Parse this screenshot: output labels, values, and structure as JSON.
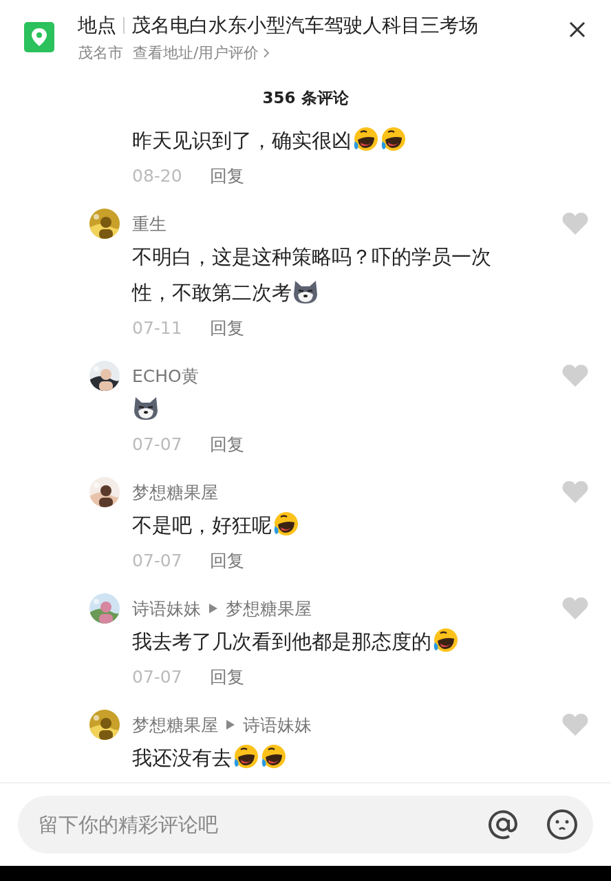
{
  "header": {
    "label": "地点",
    "title": "茂名电白水东小型汽车驾驶人科目三考场",
    "city": "茂名市",
    "link": "查看地址/用户评价"
  },
  "comment_count": "356 条评论",
  "comments": [
    {
      "parts": [
        {
          "kind": "text",
          "text": "昨天见识到了，确实很凶"
        },
        {
          "kind": "laugh-cry"
        },
        {
          "kind": "laugh-cry"
        }
      ],
      "date": "08-20",
      "reply": "回复"
    },
    {
      "author": "重生",
      "liked": false,
      "parts": [
        {
          "kind": "text",
          "text": "不明白，这是这种策略吗？吓的学员一次"
        },
        {
          "kind": "break"
        },
        {
          "kind": "text",
          "text": "性，不敢第二次考"
        },
        {
          "kind": "husky"
        }
      ],
      "date": "07-11",
      "reply": "回复"
    },
    {
      "author": "ECHO黄",
      "liked": false,
      "parts": [
        {
          "kind": "husky"
        }
      ],
      "date": "07-07",
      "reply": "回复"
    },
    {
      "author": "梦想糖果屋",
      "liked": false,
      "parts": [
        {
          "kind": "text",
          "text": "不是吧，好狂呢"
        },
        {
          "kind": "laugh-cry"
        }
      ],
      "date": "07-07",
      "reply": "回复"
    },
    {
      "author": "诗语妹妹",
      "reply_to": "梦想糖果屋",
      "liked": false,
      "parts": [
        {
          "kind": "text",
          "text": "我去考了几次看到他都是那态度的"
        },
        {
          "kind": "laugh-cry"
        }
      ],
      "date": "07-07",
      "reply": "回复"
    },
    {
      "author": "梦想糖果屋",
      "reply_to": "诗语妹妹",
      "liked": false,
      "parts": [
        {
          "kind": "text",
          "text": "我还没有去"
        },
        {
          "kind": "laugh-cry"
        },
        {
          "kind": "laugh-cry"
        }
      ]
    }
  ],
  "input": {
    "placeholder": "留下你的精彩评论吧"
  }
}
